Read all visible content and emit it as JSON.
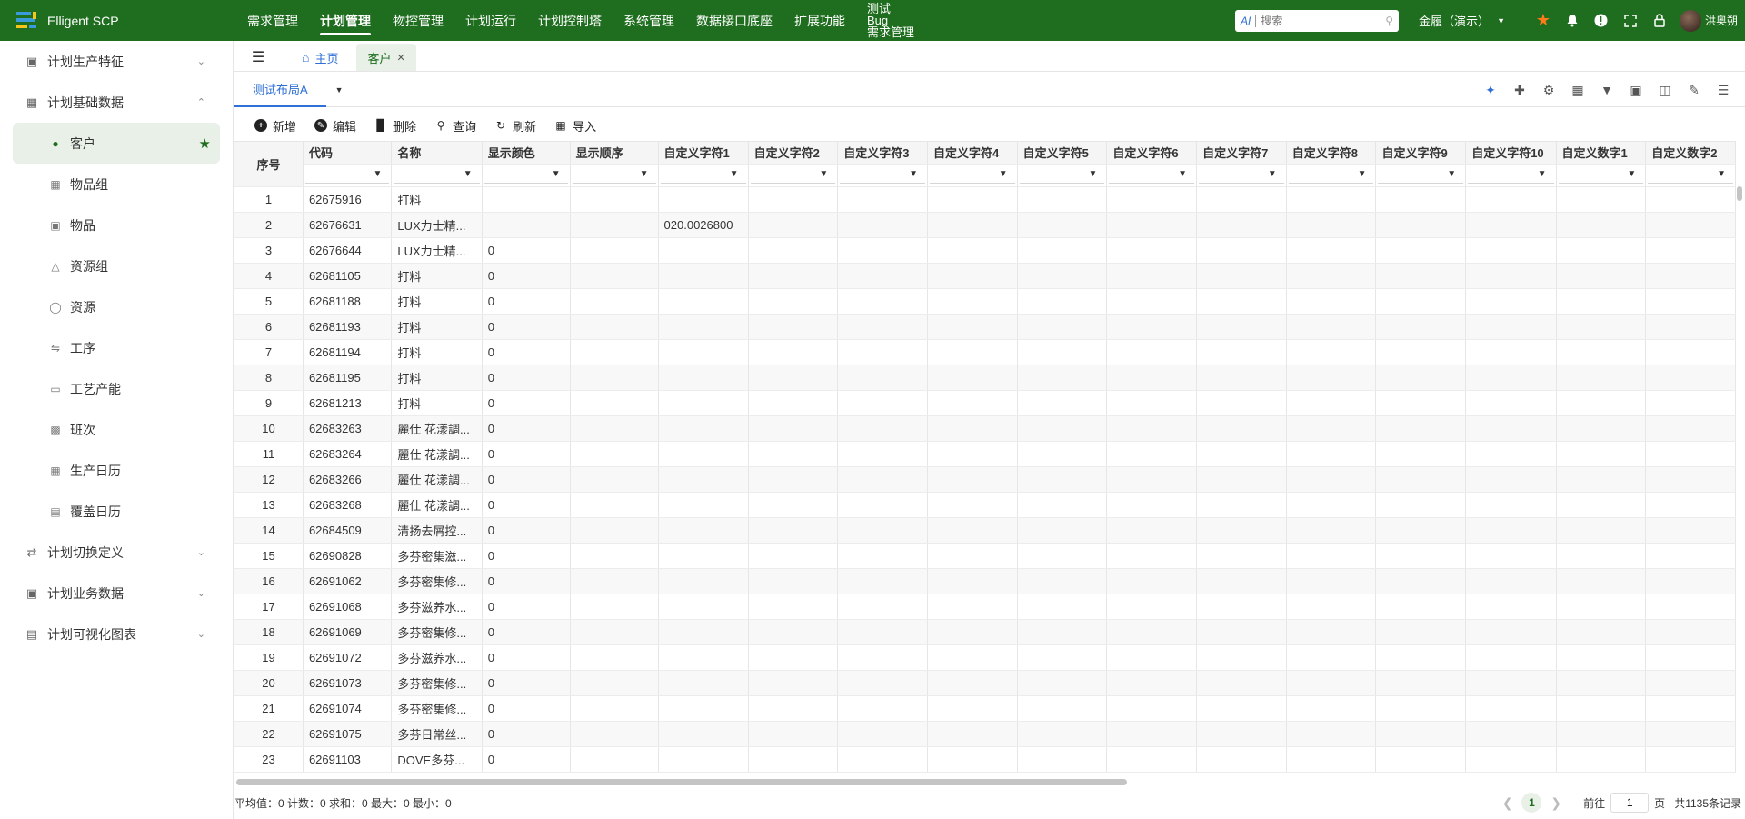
{
  "app": {
    "title": "Elligent SCP"
  },
  "topnav": {
    "items": [
      "需求管理",
      "计划管理",
      "物控管理",
      "计划运行",
      "计划控制塔",
      "系统管理",
      "数据接口底座",
      "扩展功能"
    ],
    "stack": [
      "测试",
      "Bug",
      "需求管理"
    ]
  },
  "search": {
    "ai_label": "AI",
    "placeholder": "搜索"
  },
  "tenant": {
    "label": "金履（演示）"
  },
  "user": {
    "name": "洪奥朔"
  },
  "sidebar": {
    "group1": "计划生产特征",
    "group2": "计划基础数据",
    "subitems": [
      "客户",
      "物品组",
      "物品",
      "资源组",
      "资源",
      "工序",
      "工艺产能",
      "班次",
      "生产日历",
      "覆盖日历"
    ],
    "group3": "计划切换定义",
    "group4": "计划业务数据",
    "group5": "计划可视化图表"
  },
  "tabs": {
    "home": "主页",
    "active": "客户"
  },
  "layout": {
    "name": "测试布局A"
  },
  "actions": {
    "add": "新增",
    "edit": "编辑",
    "delete": "删除",
    "query": "查询",
    "refresh": "刷新",
    "import": "导入"
  },
  "grid": {
    "columns": [
      "序号",
      "代码",
      "名称",
      "显示颜色",
      "显示顺序",
      "自定义字符1",
      "自定义字符2",
      "自定义字符3",
      "自定义字符4",
      "自定义字符5",
      "自定义字符6",
      "自定义字符7",
      "自定义字符8",
      "自定义字符9",
      "自定义字符10",
      "自定义数字1",
      "自定义数字2"
    ],
    "rows": [
      [
        "1",
        "62675916",
        "打料",
        "",
        "",
        ""
      ],
      [
        "2",
        "62676631",
        "LUX力士精...",
        "",
        "",
        "020.0026800"
      ],
      [
        "3",
        "62676644",
        "LUX力士精...",
        "0",
        "",
        ""
      ],
      [
        "4",
        "62681105",
        "打料",
        "0",
        "",
        ""
      ],
      [
        "5",
        "62681188",
        "打料",
        "0",
        "",
        ""
      ],
      [
        "6",
        "62681193",
        "打料",
        "0",
        "",
        ""
      ],
      [
        "7",
        "62681194",
        "打料",
        "0",
        "",
        ""
      ],
      [
        "8",
        "62681195",
        "打料",
        "0",
        "",
        ""
      ],
      [
        "9",
        "62681213",
        "打料",
        "0",
        "",
        ""
      ],
      [
        "10",
        "62683263",
        "麗仕 花漾調...",
        "0",
        "",
        ""
      ],
      [
        "11",
        "62683264",
        "麗仕 花漾調...",
        "0",
        "",
        ""
      ],
      [
        "12",
        "62683266",
        "麗仕 花漾調...",
        "0",
        "",
        ""
      ],
      [
        "13",
        "62683268",
        "麗仕 花漾調...",
        "0",
        "",
        ""
      ],
      [
        "14",
        "62684509",
        "清扬去屑控...",
        "0",
        "",
        ""
      ],
      [
        "15",
        "62690828",
        "多芬密集滋...",
        "0",
        "",
        ""
      ],
      [
        "16",
        "62691062",
        "多芬密集修...",
        "0",
        "",
        ""
      ],
      [
        "17",
        "62691068",
        "多芬滋养水...",
        "0",
        "",
        ""
      ],
      [
        "18",
        "62691069",
        "多芬密集修...",
        "0",
        "",
        ""
      ],
      [
        "19",
        "62691072",
        "多芬滋养水...",
        "0",
        "",
        ""
      ],
      [
        "20",
        "62691073",
        "多芬密集修...",
        "0",
        "",
        ""
      ],
      [
        "21",
        "62691074",
        "多芬密集修...",
        "0",
        "",
        ""
      ],
      [
        "22",
        "62691075",
        "多芬日常丝...",
        "0",
        "",
        ""
      ],
      [
        "23",
        "62691103",
        "DOVE多芬...",
        "0",
        "",
        ""
      ]
    ]
  },
  "footer": {
    "stats": "平均值：0 计数：0 求和：0 最大：0 最小：0",
    "page": "1",
    "goto_label": "前往",
    "goto_value": "1",
    "page_unit": "页",
    "total": "共1135条记录"
  },
  "colors": {
    "brand": "#1f6e1f",
    "accent": "#2f6fd6",
    "star": "#ff7a1a"
  }
}
